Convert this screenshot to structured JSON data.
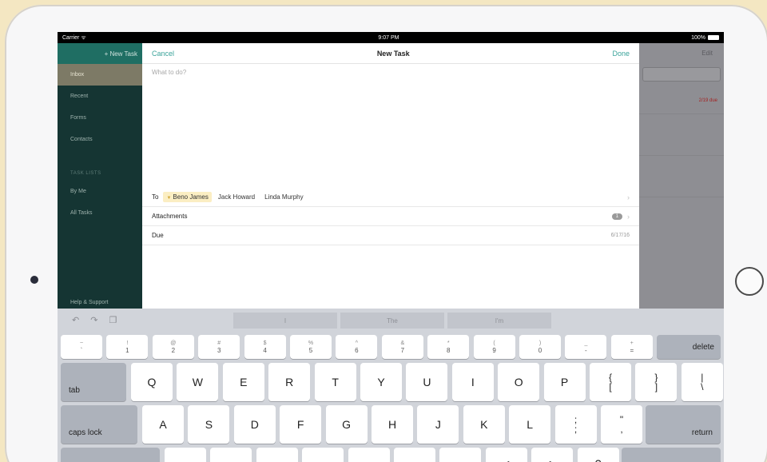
{
  "status_bar": {
    "carrier": "Carrier ᯤ",
    "time": "9:07 PM",
    "battery": "100%"
  },
  "sidebar": {
    "header_label": "+ New Task",
    "items": [
      {
        "label": "Inbox"
      },
      {
        "label": "Recent"
      },
      {
        "label": "Forms"
      },
      {
        "label": "Contacts"
      }
    ],
    "section_title": "TASK LISTS",
    "list_items": [
      {
        "label": "By Me"
      },
      {
        "label": "All Tasks"
      }
    ],
    "help_label": "Help & Support"
  },
  "right_pane": {
    "edit_label": "Edit",
    "overdue_label": "2/19 due"
  },
  "modal": {
    "cancel_label": "Cancel",
    "title": "New Task",
    "done_label": "Done",
    "task_placeholder": "What to do?",
    "to_label": "To",
    "recipients": [
      {
        "name": "Beno James"
      },
      {
        "name": "Jack Howard"
      },
      {
        "name": "Linda Murphy"
      }
    ],
    "attachments_label": "Attachments",
    "attachments_count": "1",
    "due_label": "Due",
    "due_value": "6/17/16"
  },
  "keyboard": {
    "suggestions": [
      "I",
      "The",
      "I'm"
    ],
    "number_row": [
      {
        "top": "~",
        "bottom": "`"
      },
      {
        "top": "!",
        "bottom": "1"
      },
      {
        "top": "@",
        "bottom": "2"
      },
      {
        "top": "#",
        "bottom": "3"
      },
      {
        "top": "$",
        "bottom": "4"
      },
      {
        "top": "%",
        "bottom": "5"
      },
      {
        "top": "^",
        "bottom": "6"
      },
      {
        "top": "&",
        "bottom": "7"
      },
      {
        "top": "*",
        "bottom": "8"
      },
      {
        "top": "(",
        "bottom": "9"
      },
      {
        "top": ")",
        "bottom": "0"
      },
      {
        "top": "_",
        "bottom": "-"
      },
      {
        "top": "+",
        "bottom": "="
      }
    ],
    "delete_label": "delete",
    "tab_label": "tab",
    "row1": [
      "Q",
      "W",
      "E",
      "R",
      "T",
      "Y",
      "U",
      "I",
      "O",
      "P"
    ],
    "row1_extra": [
      {
        "top": "{",
        "bottom": "["
      },
      {
        "top": "}",
        "bottom": "]"
      },
      {
        "top": "|",
        "bottom": "\\"
      }
    ],
    "caps_label": "caps lock",
    "row2": [
      "A",
      "S",
      "D",
      "F",
      "G",
      "H",
      "J",
      "K",
      "L"
    ],
    "row2_extra": [
      {
        "top": ";",
        "bottom": ";"
      },
      {
        "top": "\"",
        "bottom": ","
      }
    ],
    "return_label": "return",
    "row3_partial": [
      {
        "top": "<",
        "bottom": ""
      },
      {
        "top": ">",
        "bottom": ""
      },
      {
        "top": "?",
        "bottom": ""
      }
    ]
  }
}
